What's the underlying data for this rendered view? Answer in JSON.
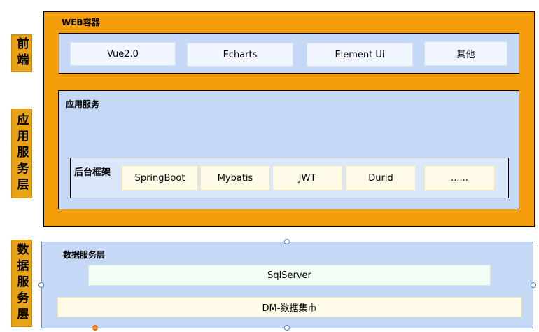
{
  "layers": {
    "frontend": "前端",
    "app_service": "应用服务层",
    "data_service": "数据服务层"
  },
  "web_container": {
    "title": "WEB容器",
    "frontend_items": [
      "Vue2.0",
      "Echarts",
      "Element Ui",
      "其他"
    ]
  },
  "app_service": {
    "title": "应用服务",
    "framework_title": "后台框架",
    "framework_items": [
      "SpringBoot",
      "Mybatis",
      "JWT",
      "Durid",
      "......"
    ]
  },
  "data_service": {
    "title": "数据服务层",
    "items": [
      "SqlServer",
      "DM-数据集市"
    ]
  },
  "colors": {
    "label_bg": "#e8a317",
    "container_bg": "#f59e0b",
    "panel_bg": "#c5d9f7",
    "selection_handle": "#4a7bd0"
  }
}
